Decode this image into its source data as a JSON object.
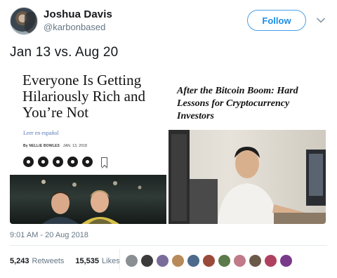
{
  "user": {
    "name": "Joshua Davis",
    "handle": "@karbonbased",
    "follow_label": "Follow"
  },
  "tweet": {
    "text": "Jan 13 vs. Aug 20",
    "timestamp": "9:01 AM - 20 Aug 2018"
  },
  "left_card": {
    "headline": "Everyone Is Getting Hilariously Rich and You’re Not",
    "sub_link": "Leer en español",
    "byline_author": "By NELLIE BOWLES",
    "byline_date": "JAN. 13, 2018"
  },
  "right_card": {
    "headline": "After the Bitcoin Boom: Hard Lessons for Cryptocurrency Investors"
  },
  "stats": {
    "retweets_count": "5,243",
    "retweets_label": "Retweets",
    "likes_count": "15,535",
    "likes_label": "Likes"
  },
  "colors": {
    "follow_blue": "#1d8ee6",
    "muted_text": "#657786",
    "nyt_link": "#5a7bb8"
  },
  "likers": [
    "#8a8f94",
    "#3b3b3b",
    "#7a6c9a",
    "#b88a5a",
    "#4d6a8a",
    "#9a4a3a",
    "#5c7a4a",
    "#c07a8a",
    "#6a5a4a",
    "#b04060",
    "#7a3a8a"
  ]
}
